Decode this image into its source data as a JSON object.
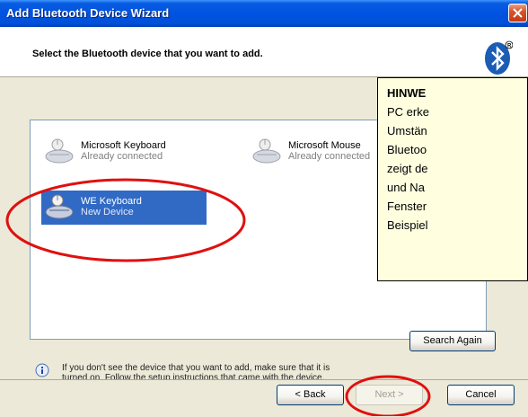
{
  "window": {
    "title": "Add Bluetooth Device Wizard",
    "close_glyph": "X"
  },
  "header": {
    "title": "Select the Bluetooth device that you want to add.",
    "logo": "bluetooth-logo"
  },
  "devices": [
    {
      "name": "Microsoft Keyboard",
      "status": "Already connected",
      "selected": false,
      "icon": "keyboard-mouse-icon"
    },
    {
      "name": "Microsoft Mouse",
      "status": "Already connected",
      "selected": false,
      "icon": "keyboard-mouse-icon"
    },
    {
      "name": "WE Keyboard",
      "status": "New Device",
      "selected": true,
      "icon": "keyboard-mouse-icon"
    }
  ],
  "info": {
    "text": "If you don't see the device that you want to add, make sure that it is turned on. Follow the setup instructions that came with the device, and then click Search Again."
  },
  "buttons": {
    "search_again": "Search Again",
    "back": "< Back",
    "next": "Next >",
    "cancel": "Cancel"
  },
  "note": {
    "lines": [
      "HINWE",
      "PC erke",
      "Umstän",
      "Bluetoo",
      "zeigt de",
      "und Na",
      "Fenster",
      "Beispiel"
    ]
  },
  "colors": {
    "titlebar": "#0053e1",
    "selection": "#316ac5",
    "annotation_red": "#e01010",
    "note_bg": "#ffffe0"
  }
}
